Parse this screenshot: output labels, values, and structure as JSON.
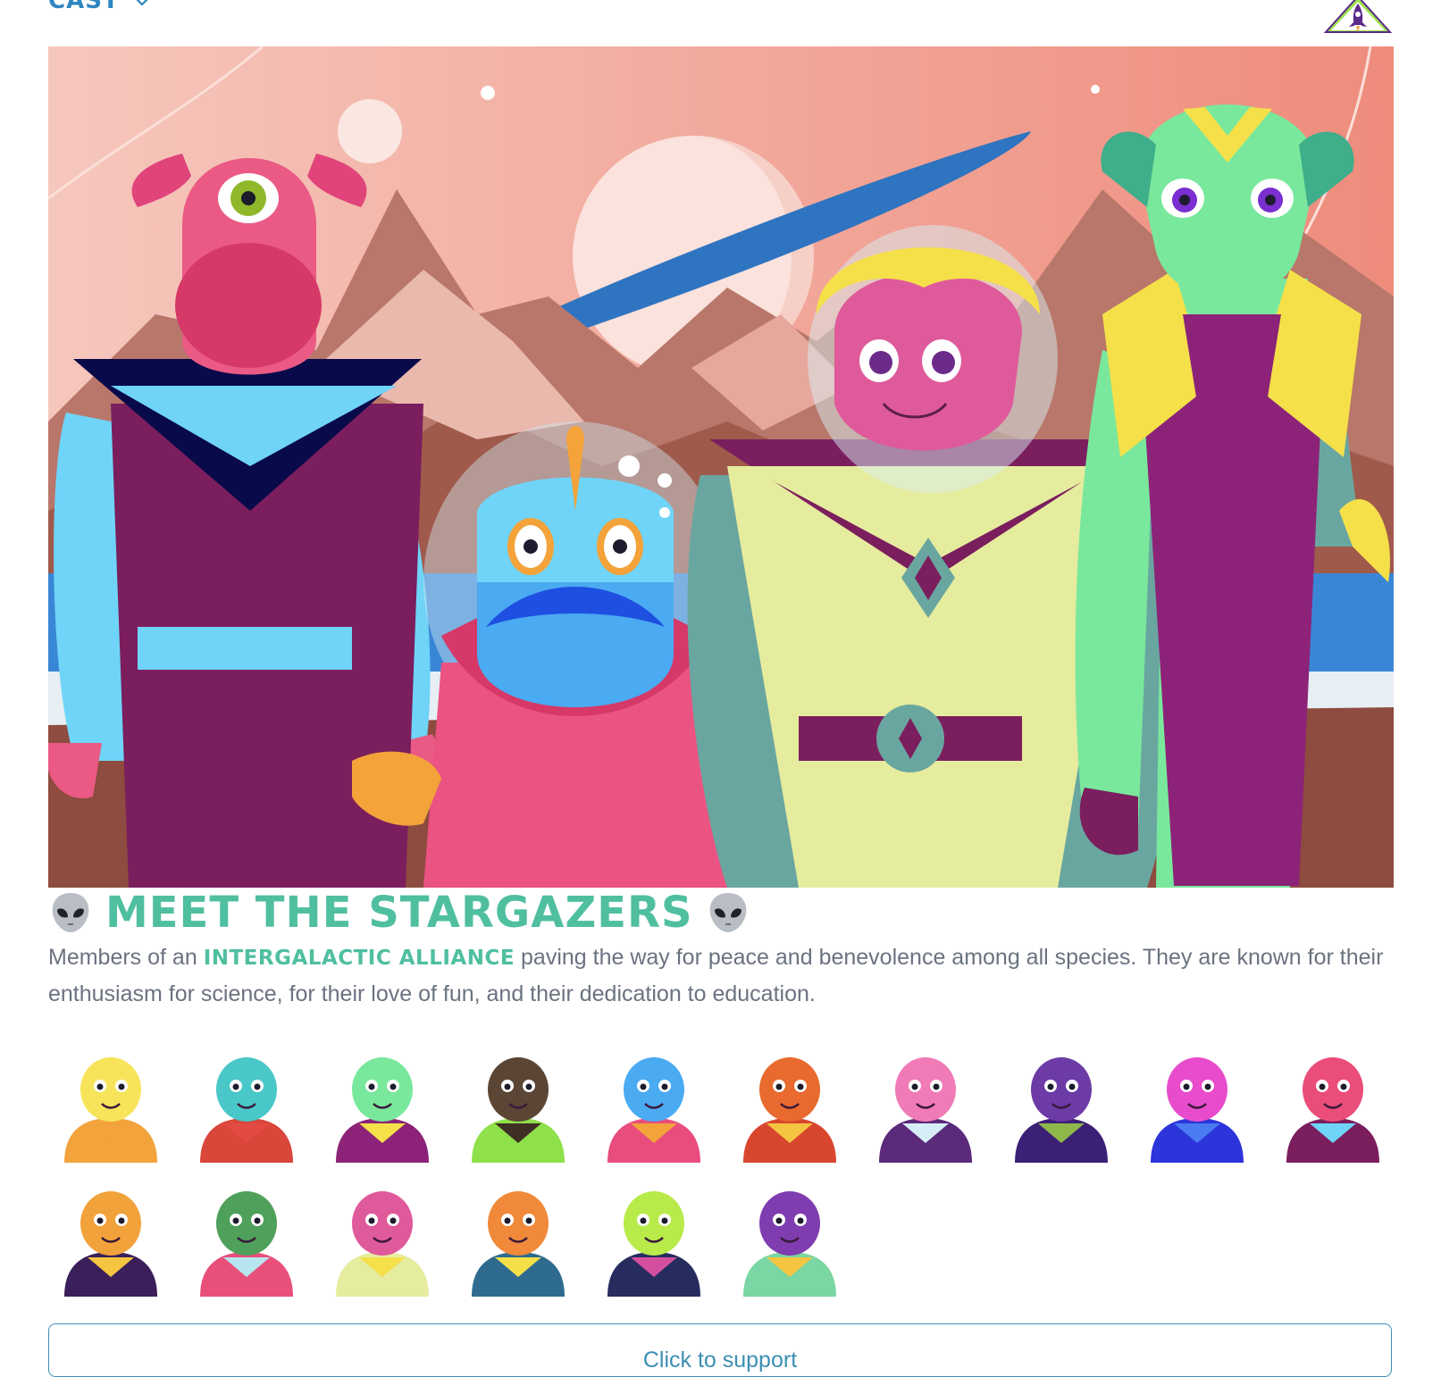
{
  "nav": {
    "menu_label": "CAST",
    "menu_icon": "chevron-down-icon",
    "logo_icon": "rocket-badge-logo"
  },
  "hero": {
    "image": "stargazers-group-illustration"
  },
  "section": {
    "title": "MEET THE STARGAZERS",
    "title_icon": "alien-face-emoji",
    "description_before": "Members of an ",
    "description_highlight": "INTERGALACTIC ALLIANCE",
    "description_after": " paving the way for peace and benevolence among all species. They are known for their enthusiasm for science, for their love of fun, and their dedication to education."
  },
  "cast": [
    {
      "icon": "yellow-helmet-alien-avatar",
      "head": "#f7e45a",
      "body": "#f2a33c",
      "accent": "#f2a33c"
    },
    {
      "icon": "cyclops-robot-alien-avatar",
      "head": "#49c7c9",
      "body": "#d9463a",
      "accent": "#e34a43"
    },
    {
      "icon": "green-lady-alien-avatar",
      "head": "#79e89c",
      "body": "#8c2378",
      "accent": "#f5e04a"
    },
    {
      "icon": "brown-hat-alien-avatar",
      "head": "#5b4636",
      "body": "#8fe04a",
      "accent": "#3e2f25"
    },
    {
      "icon": "blue-fish-alien-avatar",
      "head": "#4aaaf2",
      "body": "#e84d7d",
      "accent": "#f3a33a"
    },
    {
      "icon": "orange-visor-alien-avatar",
      "head": "#e86a2e",
      "body": "#d9462e",
      "accent": "#f5c542"
    },
    {
      "icon": "pink-jar-alien-avatar",
      "head": "#f07bb7",
      "body": "#5b2a7a",
      "accent": "#d8eef7"
    },
    {
      "icon": "purple-furry-alien-avatar",
      "head": "#6c3ba6",
      "body": "#3c2076",
      "accent": "#8fb84a"
    },
    {
      "icon": "pink-antenna-alien-avatar",
      "head": "#e84ccc",
      "body": "#2c35d9",
      "accent": "#4a7bf2"
    },
    {
      "icon": "pink-cyclops-alien-avatar",
      "head": "#ea4d7a",
      "body": "#7b1e5e",
      "accent": "#6fd4f7"
    },
    {
      "icon": "orange-trunk-alien-avatar",
      "head": "#f2a23a",
      "body": "#3b1f5a",
      "accent": "#f5c542"
    },
    {
      "icon": "green-frog-helmet-alien-avatar",
      "head": "#4fa05a",
      "body": "#e8507a",
      "accent": "#b8e6f0"
    },
    {
      "icon": "blond-helmet-alien-avatar",
      "head": "#df5a9b",
      "body": "#e6ec9e",
      "accent": "#f5e04a"
    },
    {
      "icon": "orange-stalk-alien-avatar",
      "head": "#f08a3a",
      "body": "#2f6a8f",
      "accent": "#f5e04a"
    },
    {
      "icon": "lime-bubble-alien-avatar",
      "head": "#b8ea4a",
      "body": "#262c5e",
      "accent": "#d34fa0"
    },
    {
      "icon": "purple-striped-alien-avatar",
      "head": "#7f3db0",
      "body": "#7ad6a2",
      "accent": "#f5c542"
    }
  ],
  "support_button": {
    "label": "Click to support"
  }
}
